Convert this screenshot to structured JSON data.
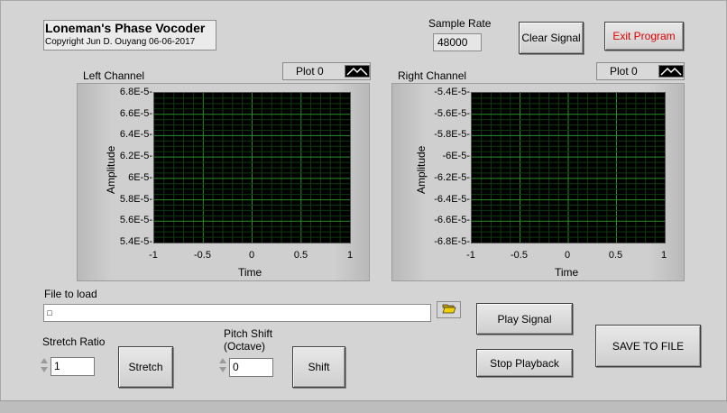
{
  "app": {
    "title": "Loneman's Phase Vocoder",
    "copyright": "Copyright Jun D. Ouyang 06-06-2017"
  },
  "sample_rate": {
    "label": "Sample Rate",
    "value": "48000"
  },
  "buttons": {
    "clear_signal": "Clear Signal",
    "exit_program": "Exit Program",
    "play_signal": "Play Signal",
    "stop_playback": "Stop Playback",
    "save_to_file": "SAVE TO FILE",
    "stretch": "Stretch",
    "shift": "Shift"
  },
  "left_graph": {
    "title": "Left Channel",
    "legend": "Plot 0",
    "ylabel": "Amplitude",
    "xlabel": "Time",
    "yticks": [
      "6.8E-5-",
      "6.6E-5-",
      "6.4E-5-",
      "6.2E-5-",
      "6E-5-",
      "5.8E-5-",
      "5.6E-5-",
      "5.4E-5-"
    ],
    "xticks": [
      "-1",
      "-0.5",
      "0",
      "0.5",
      "1"
    ]
  },
  "right_graph": {
    "title": "Right Channel",
    "legend": "Plot 0",
    "ylabel": "Amplitude",
    "xlabel": "Time",
    "yticks": [
      "-5.4E-5-",
      "-5.6E-5-",
      "-5.8E-5-",
      "-6E-5-",
      "-6.2E-5-",
      "-6.4E-5-",
      "-6.6E-5-",
      "-6.8E-5-"
    ],
    "xticks": [
      "-1",
      "-0.5",
      "0",
      "0.5",
      "1"
    ]
  },
  "file": {
    "label": "File to load",
    "value": ""
  },
  "stretch_ratio": {
    "label": "Stretch Ratio",
    "value": "1"
  },
  "pitch_shift": {
    "label_line1": "Pitch Shift",
    "label_line2": "(Octave)",
    "value": "0"
  },
  "colors": {
    "plot_bg": "#000000",
    "grid": "#1f7a1f",
    "exit_text": "#e00000"
  }
}
